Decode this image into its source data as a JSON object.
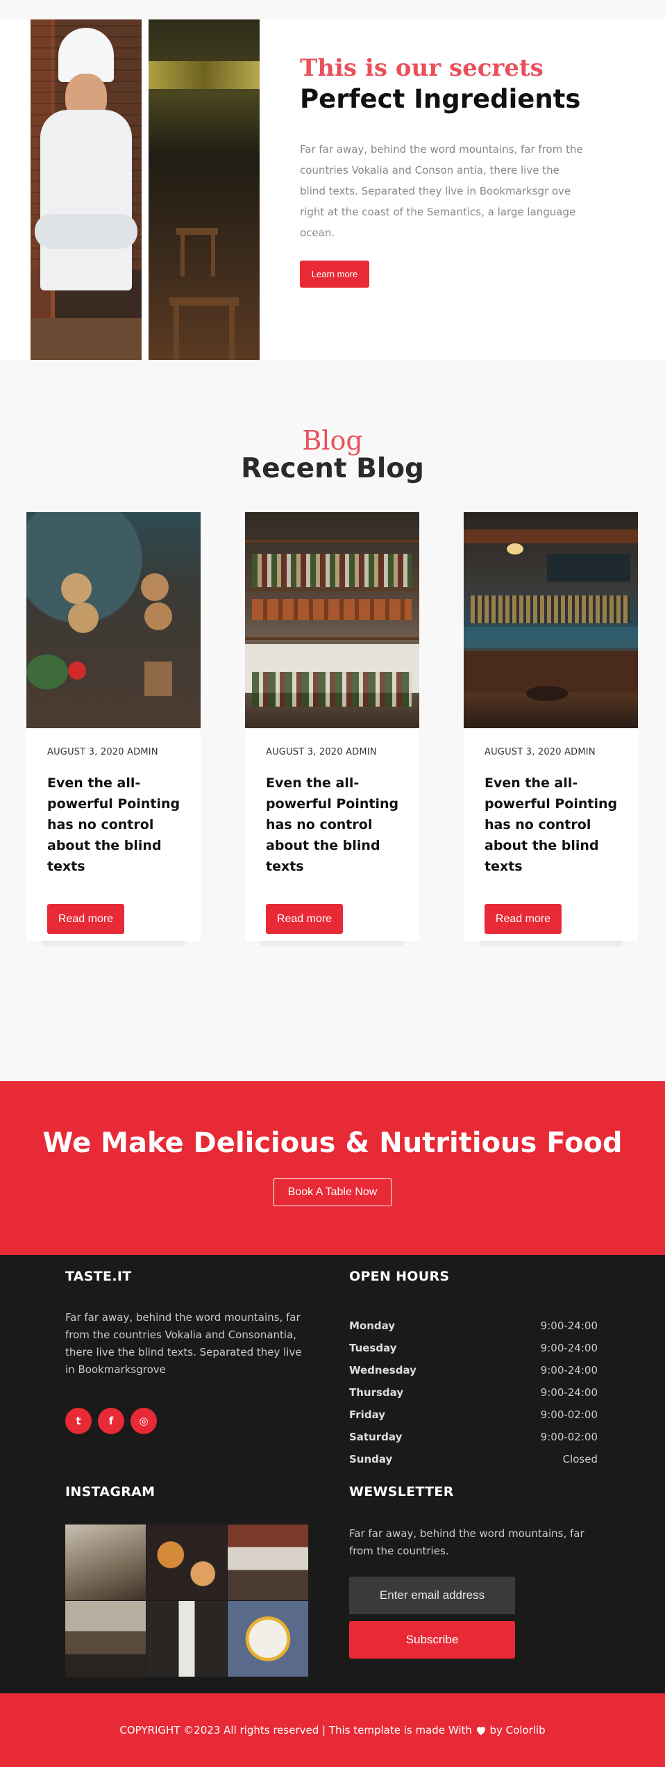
{
  "about": {
    "subtitle": "This is our secrets",
    "title": "Perfect Ingredients",
    "description": "Far far away, behind the word mountains, far from the countries Vokalia and Conson antia, there live the blind texts. Separated they live in Bookmarksgr ove right at the coast of the Semantics, a large language ocean.",
    "button_label": "Learn more"
  },
  "blog": {
    "subtitle": "Blog",
    "title": "Recent Blog",
    "posts": [
      {
        "meta": "AUGUST 3, 2020 ADMIN",
        "title": "Even the all-powerful Pointing has no control about the blind texts",
        "button_label": "Read more"
      },
      {
        "meta": "AUGUST 3, 2020 ADMIN",
        "title": "Even the all-powerful Pointing has no control about the blind texts",
        "button_label": "Read more"
      },
      {
        "meta": "AUGUST 3, 2020 ADMIN",
        "title": "Even the all-powerful Pointing has no control about the blind texts",
        "button_label": "Read more"
      }
    ]
  },
  "cta": {
    "title": "We Make Delicious & Nutritious Food",
    "button_label": "Book A Table Now"
  },
  "footer": {
    "brand": {
      "title": "TASTE.IT",
      "description": "Far far away, behind the word mountains, far from the countries Vokalia and Consonantia, there live the blind texts. Separated they live in Bookmarksgrove",
      "social": [
        {
          "icon": "twitter-icon",
          "glyph": "t"
        },
        {
          "icon": "facebook-icon",
          "glyph": "f"
        },
        {
          "icon": "instagram-icon",
          "glyph": "◎"
        }
      ]
    },
    "hours": {
      "title": "OPEN HOURS",
      "rows": [
        {
          "day": "Monday",
          "time": "9:00-24:00"
        },
        {
          "day": "Tuesday",
          "time": "9:00-24:00"
        },
        {
          "day": "Wednesday",
          "time": "9:00-24:00"
        },
        {
          "day": "Thursday",
          "time": "9:00-24:00"
        },
        {
          "day": "Friday",
          "time": "9:00-02:00"
        },
        {
          "day": "Saturday",
          "time": "9:00-02:00"
        },
        {
          "day": "Sunday",
          "time": "Closed"
        }
      ]
    },
    "instagram": {
      "title": "INSTAGRAM"
    },
    "newsletter": {
      "title": "WEWSLETTER",
      "description": "Far far away, behind the word mountains, far from the countries.",
      "email_placeholder": "Enter email address",
      "button_label": "Subscribe"
    },
    "copyright_before": "COPYRIGHT ©2023 All rights reserved | This template is made With",
    "copyright_after": "by Colorlib"
  },
  "colors": {
    "accent": "#e72a36",
    "accent_soft": "#e8515b",
    "footer_bg": "#1a1a1a"
  }
}
